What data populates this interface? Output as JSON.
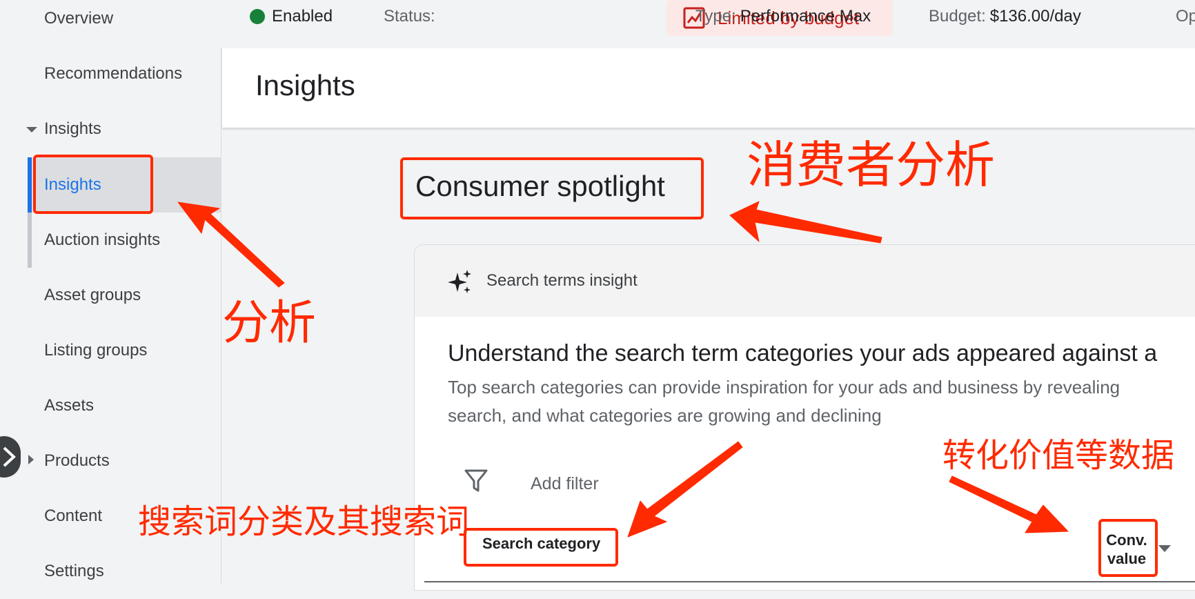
{
  "sidebar": {
    "items": [
      {
        "label": "Overview"
      },
      {
        "label": "Recommendations"
      },
      {
        "label": "Insights"
      },
      {
        "label": "Insights"
      },
      {
        "label": "Auction insights"
      },
      {
        "label": "Asset groups"
      },
      {
        "label": "Listing groups"
      },
      {
        "label": "Assets"
      },
      {
        "label": "Products"
      },
      {
        "label": "Content"
      },
      {
        "label": "Settings"
      }
    ]
  },
  "status_bar": {
    "enabled_label": "Enabled",
    "status_label": "Status:",
    "status_value": "Limited by budget",
    "type_label": "Type:",
    "type_value": "Performance Max",
    "budget_label": "Budget:",
    "budget_value": "$136.00/day",
    "truncated": "Op"
  },
  "page": {
    "title": "Insights"
  },
  "section": {
    "title": "Consumer spotlight"
  },
  "card": {
    "header_label": "Search terms insight",
    "title": "Understand the search term categories your ads appeared against a",
    "description_line1": "Top search categories can provide inspiration for your ads and business by revealing",
    "description_line2": "search, and what categories are growing and declining",
    "filter_label": "Add filter",
    "columns": [
      "Search category",
      "Conv.",
      "value"
    ]
  },
  "annotations": {
    "consumer_analysis": "消费者分析",
    "analysis": "分析",
    "conversion_data": "转化价值等数据",
    "search_category_note": "搜索词分类及其搜索词"
  },
  "colors": {
    "accent": "#1a73e8",
    "status_red": "#c5221f",
    "enabled_green": "#188038",
    "annotation_red": "#ff2a00"
  }
}
